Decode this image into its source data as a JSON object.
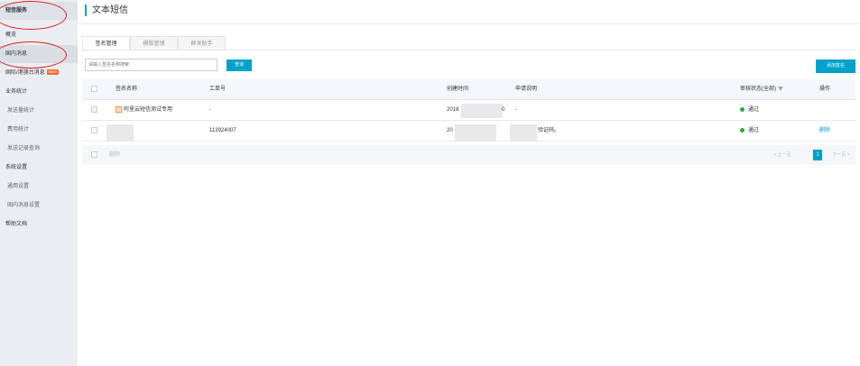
{
  "sidebar": {
    "title": "短信服务",
    "items": [
      {
        "label": "概览"
      },
      {
        "label": "国内消息"
      },
      {
        "label": "国际/港澳台消息",
        "badge": "NEW"
      },
      {
        "label": "业务统计"
      },
      {
        "label": "发送量统计"
      },
      {
        "label": "费用统计"
      },
      {
        "label": "发送记录查询"
      },
      {
        "label": "系统设置"
      },
      {
        "label": "通用设置"
      },
      {
        "label": "国内消息设置"
      },
      {
        "label": "帮助文档"
      }
    ]
  },
  "header": {
    "title": "文本短信"
  },
  "tabs": [
    {
      "label": "签名管理"
    },
    {
      "label": "模版管理"
    },
    {
      "label": "群发助手"
    }
  ],
  "search": {
    "placeholder": "请输入签名名称搜索",
    "button": "查询"
  },
  "actions": {
    "add": "添加签名"
  },
  "table": {
    "columns": [
      "签名名称",
      "工单号",
      "创建时间",
      "申请说明",
      "审核状态(全部)",
      "操作"
    ],
    "rows": [
      {
        "name": "阿里云短信测试专用",
        "ticket": "-",
        "created": "2018",
        "created_tail": "0",
        "note": "-",
        "status": "通过",
        "action": ""
      },
      {
        "name": "",
        "ticket": "113924007",
        "created": "20",
        "note": "验证码。",
        "status": "通过",
        "action": "删除"
      }
    ],
    "footer": {
      "delete": "删除",
      "prev": "上一页",
      "page": "1",
      "next": "下一页"
    }
  },
  "colors": {
    "accent": "#00a2ca",
    "status_ok": "#1ab33c",
    "annotation": "#e02020"
  }
}
